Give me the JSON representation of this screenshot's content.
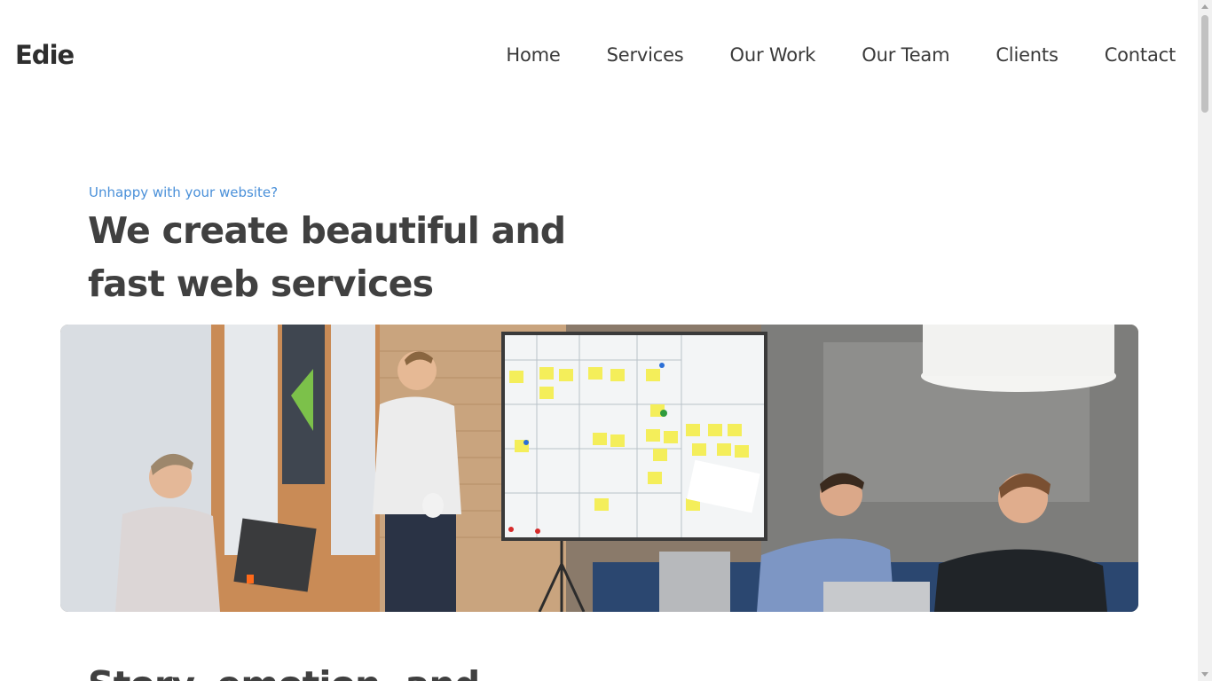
{
  "brand": {
    "logo": "Edie"
  },
  "nav": {
    "items": [
      {
        "label": "Home"
      },
      {
        "label": "Services"
      },
      {
        "label": "Our Work"
      },
      {
        "label": "Our Team"
      },
      {
        "label": "Clients"
      },
      {
        "label": "Contact"
      }
    ]
  },
  "hero": {
    "eyebrow": "Unhappy with your website?",
    "headline": "We create beautiful and fast web services",
    "image_alt": "Team meeting in front of a kanban whiteboard"
  },
  "next_section": {
    "heading": "Story, emotion, and"
  },
  "colors": {
    "accent": "#4a90d9",
    "text": "#404040",
    "background": "#ffffff"
  }
}
